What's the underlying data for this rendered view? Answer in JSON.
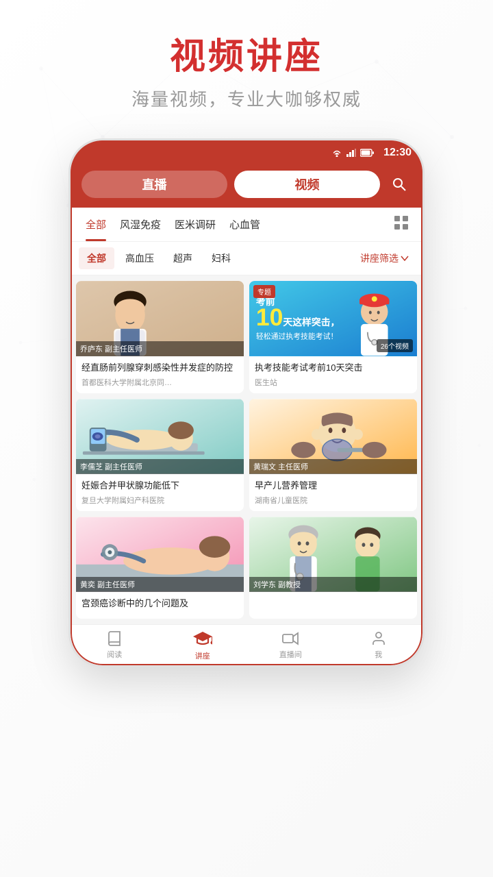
{
  "page": {
    "title": "视频讲座",
    "subtitle": "海量视频，专业大咖够权威"
  },
  "status_bar": {
    "time": "12:30",
    "wifi_icon": "wifi",
    "signal_icon": "signal",
    "battery_icon": "battery"
  },
  "top_nav": {
    "tabs": [
      {
        "id": "live",
        "label": "直播",
        "active": false
      },
      {
        "id": "video",
        "label": "视频",
        "active": true
      }
    ],
    "search_label": "搜索"
  },
  "categories": {
    "main": [
      {
        "id": "all",
        "label": "全部",
        "active": true
      },
      {
        "id": "rheum",
        "label": "风湿免疫",
        "active": false
      },
      {
        "id": "survey",
        "label": "医米调研",
        "active": false
      },
      {
        "id": "cardio",
        "label": "心血管",
        "active": false
      },
      {
        "id": "more",
        "label": "+",
        "active": false
      }
    ],
    "sub": [
      {
        "id": "all",
        "label": "全部",
        "active": true
      },
      {
        "id": "hyper",
        "label": "高血压",
        "active": false
      },
      {
        "id": "ultra",
        "label": "超声",
        "active": false
      },
      {
        "id": "gyn",
        "label": "妇科",
        "active": false
      }
    ],
    "filter_label": "讲座筛选"
  },
  "videos": [
    {
      "id": 1,
      "title": "经直肠前列腺穿刺感染性并发症的防控",
      "source": "首都医科大学附属北京同…",
      "doctor": "乔庐东 副主任医师",
      "thumb_type": "doctor",
      "badge": null,
      "count": null
    },
    {
      "id": 2,
      "title": "执考技能考试考前10天突击",
      "source": "医生站",
      "doctor": null,
      "thumb_type": "featured",
      "badge": "专题",
      "count": "26个视频",
      "featured_line1": "考前",
      "featured_num": "10",
      "featured_line2": "天这样突击，",
      "featured_line3": "轻松通过执考技能考试！"
    },
    {
      "id": 3,
      "title": "妊娠合并甲状腺功能低下",
      "source": "复旦大学附属妇产科医院",
      "doctor": "李儒芝 副主任医师",
      "thumb_type": "ultrasound",
      "badge": null,
      "count": null
    },
    {
      "id": 4,
      "title": "早产儿营养管理",
      "source": "湖南省儿童医院",
      "doctor": "黄瑞文 主任医师",
      "thumb_type": "baby",
      "badge": null,
      "count": null
    },
    {
      "id": 5,
      "title": "宫颈癌诊断中的几个问题及",
      "source": "",
      "doctor": "黄奕 副主任医师",
      "thumb_type": "exam",
      "badge": null,
      "count": null
    },
    {
      "id": 6,
      "title": "",
      "source": "",
      "doctor": "刘学东 副教授",
      "thumb_type": "elderly",
      "badge": null,
      "count": null
    }
  ],
  "bottom_nav": {
    "items": [
      {
        "id": "read",
        "label": "阅读",
        "icon": "book",
        "active": false
      },
      {
        "id": "lecture",
        "label": "讲座",
        "icon": "lecture",
        "active": true
      },
      {
        "id": "live",
        "label": "直播间",
        "icon": "video",
        "active": false
      },
      {
        "id": "me",
        "label": "我",
        "icon": "user",
        "active": false
      }
    ]
  }
}
